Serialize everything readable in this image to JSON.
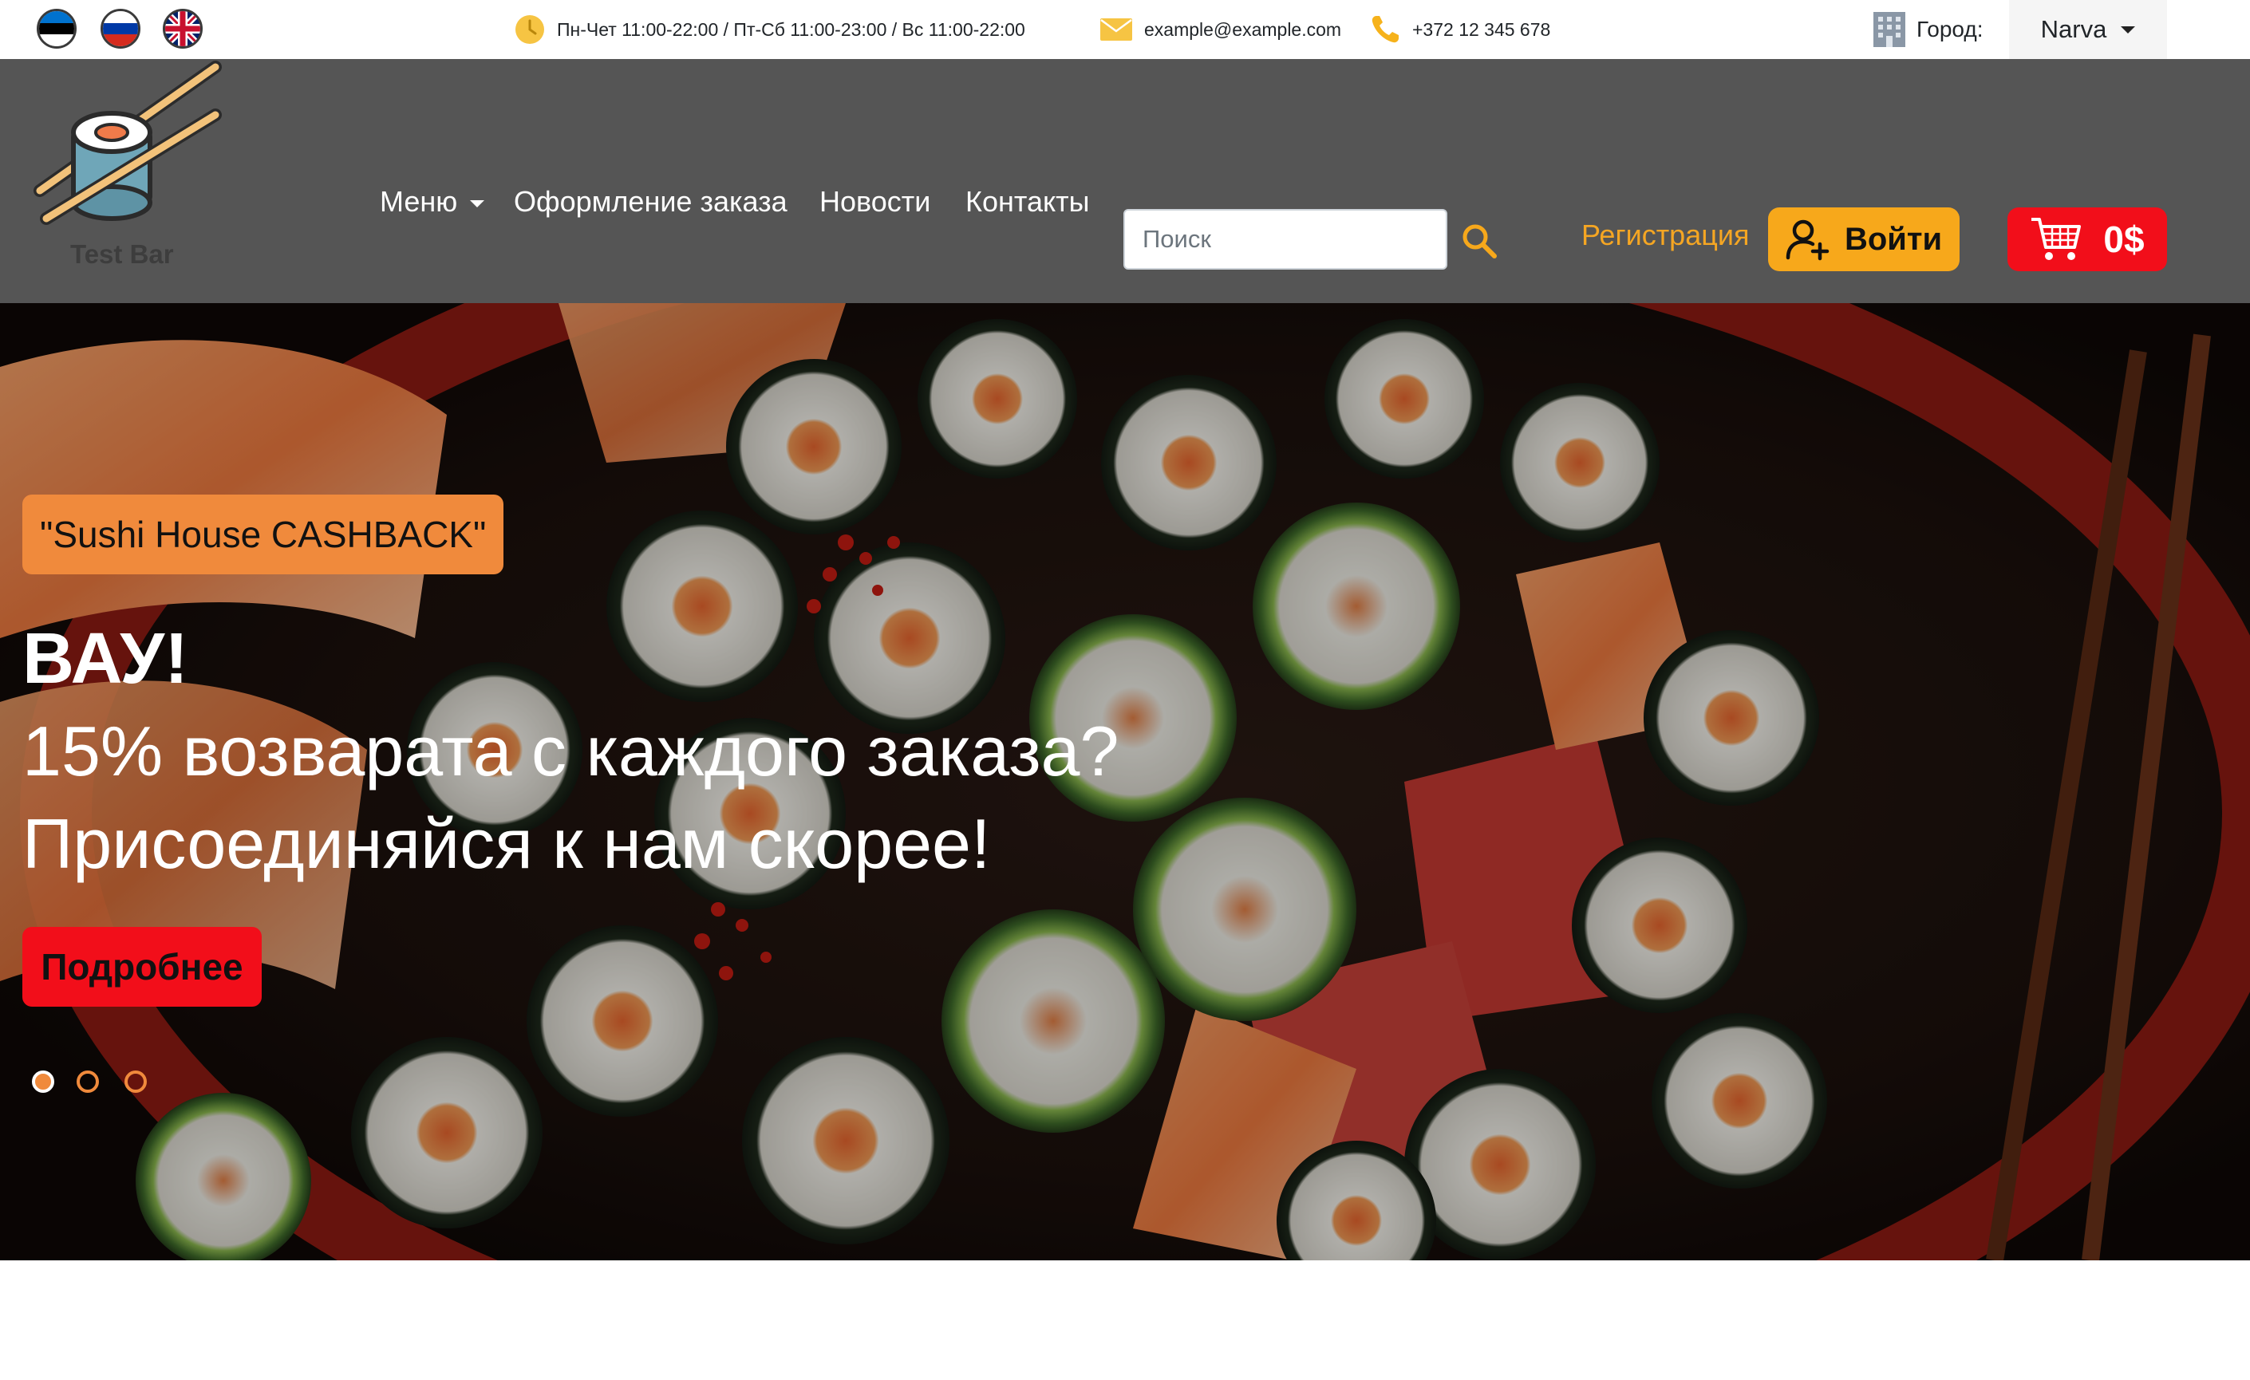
{
  "languages": [
    {
      "code": "et",
      "name": "Eesti"
    },
    {
      "code": "ru",
      "name": "Русский"
    },
    {
      "code": "en",
      "name": "English"
    }
  ],
  "topbar": {
    "hours": "Пн-Чет 11:00-22:00 / Пт-Сб 11:00-23:00 / Вс 11:00-22:00",
    "email": "example@example.com",
    "phone": "+372 12 345 678",
    "city_label": "Город:",
    "city_value": "Narva"
  },
  "header": {
    "logo_text": "Test Bar",
    "nav": {
      "menu": "Меню",
      "order": "Оформление заказа",
      "news": "Новости",
      "contacts": "Контакты"
    },
    "search_placeholder": "Поиск",
    "register": "Регистрация",
    "login": "Войти",
    "cart_total": "0$"
  },
  "hero": {
    "badge": "\"Sushi House CASHBACK\"",
    "headline": [
      "ВАУ!",
      "15% возварата с каждого заказа?",
      "Присоединяйся к нам скорее!"
    ],
    "button": "Подробнее",
    "slides_count": 3,
    "active_slide": 1
  },
  "colors": {
    "header_bg": "#555555",
    "accent_orange": "#f7a81b",
    "accent_red": "#f20e1a",
    "badge_orange": "#f08a3c"
  }
}
